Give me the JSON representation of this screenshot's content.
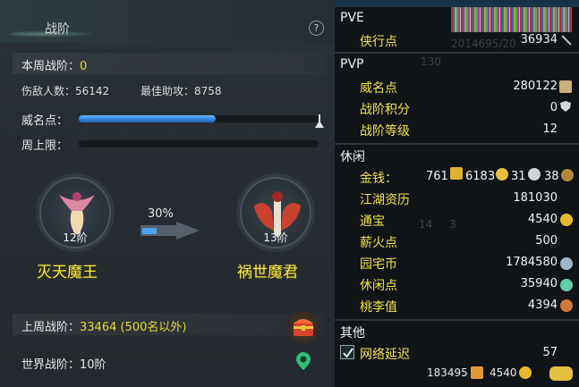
{
  "left": {
    "title": "战阶",
    "help": "?",
    "weekly": {
      "label": "本周战阶：",
      "value": "0"
    },
    "injured": {
      "label": "伤敌人数：",
      "value": "56142"
    },
    "best_assist": {
      "label": "最佳助攻：",
      "value": "8758"
    },
    "prestige": {
      "label": "威名点：",
      "progress": 0.57
    },
    "weekly_cap": {
      "label": "周上限：",
      "progress": 0.0
    },
    "current_rank": {
      "tier": "12阶",
      "name": "灭天魔王"
    },
    "progress_pct": "30%",
    "next_rank": {
      "tier": "13阶",
      "name": "祸世魔君"
    },
    "last_week": {
      "label": "上周战阶：",
      "value": "33464 (500名以外)"
    },
    "world": {
      "label": "世界战阶：",
      "value": "10阶"
    },
    "icons": {
      "chest": "treasure-chest-icon",
      "pin": "location-pin-icon"
    }
  },
  "right": {
    "pve": {
      "title": "PVE",
      "items": [
        {
          "label": "侠行点",
          "value": "36934"
        }
      ]
    },
    "pvp": {
      "title": "PVP",
      "items": [
        {
          "label": "威名点",
          "value": "280122"
        },
        {
          "label": "战阶积分",
          "value": "0"
        },
        {
          "label": "战阶等级",
          "value": "12"
        }
      ]
    },
    "leisure": {
      "title": "休闲",
      "money": {
        "label": "金钱：",
        "v1": "761",
        "v2": "6183",
        "v3": "31",
        "v4": "38"
      },
      "items": [
        {
          "label": "江湖资历",
          "value": "181030"
        },
        {
          "label": "通宝",
          "value": "4540"
        },
        {
          "label": "薪火点",
          "value": "500"
        },
        {
          "label": "园宅币",
          "value": "1784580"
        },
        {
          "label": "休闲点",
          "value": "35940"
        },
        {
          "label": "桃李值",
          "value": "4394"
        }
      ]
    },
    "other": {
      "title": "其他",
      "network": {
        "label": "网络延迟",
        "value": "57",
        "checked": true
      }
    },
    "bottom": {
      "v1": "183495",
      "v2": "4540"
    },
    "ghost_text": {
      "g1": "2014695/20",
      "g2": "130",
      "g3": "14",
      "g4": "3"
    }
  },
  "colors": {
    "accent_yellow": "#e6dc2e",
    "bar_blue": "#2f7fd9",
    "panel_bg": "#262c32",
    "right_bg": "#101417"
  }
}
